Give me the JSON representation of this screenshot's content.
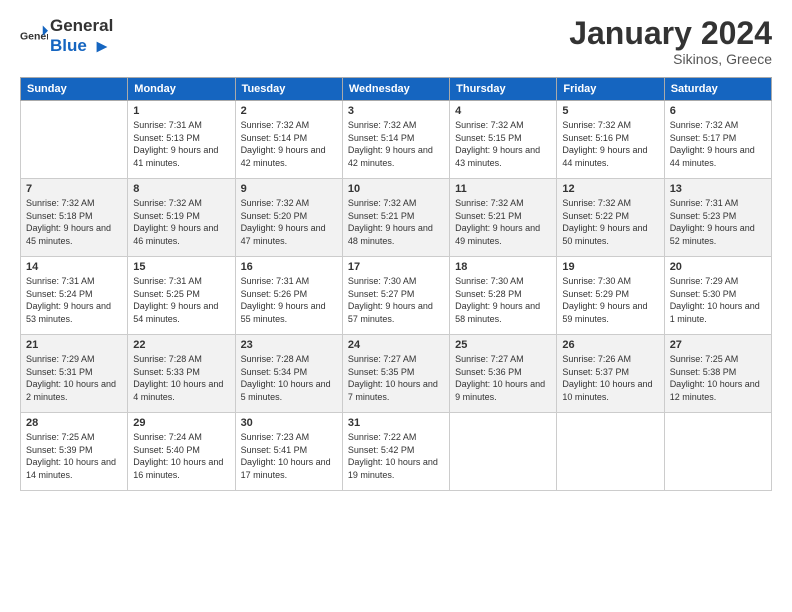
{
  "header": {
    "logo_general": "General",
    "logo_blue": "Blue",
    "month_title": "January 2024",
    "location": "Sikinos, Greece"
  },
  "days_of_week": [
    "Sunday",
    "Monday",
    "Tuesday",
    "Wednesday",
    "Thursday",
    "Friday",
    "Saturday"
  ],
  "weeks": [
    [
      {
        "day": "",
        "sunrise": "",
        "sunset": "",
        "daylight": ""
      },
      {
        "day": "1",
        "sunrise": "Sunrise: 7:31 AM",
        "sunset": "Sunset: 5:13 PM",
        "daylight": "Daylight: 9 hours and 41 minutes."
      },
      {
        "day": "2",
        "sunrise": "Sunrise: 7:32 AM",
        "sunset": "Sunset: 5:14 PM",
        "daylight": "Daylight: 9 hours and 42 minutes."
      },
      {
        "day": "3",
        "sunrise": "Sunrise: 7:32 AM",
        "sunset": "Sunset: 5:14 PM",
        "daylight": "Daylight: 9 hours and 42 minutes."
      },
      {
        "day": "4",
        "sunrise": "Sunrise: 7:32 AM",
        "sunset": "Sunset: 5:15 PM",
        "daylight": "Daylight: 9 hours and 43 minutes."
      },
      {
        "day": "5",
        "sunrise": "Sunrise: 7:32 AM",
        "sunset": "Sunset: 5:16 PM",
        "daylight": "Daylight: 9 hours and 44 minutes."
      },
      {
        "day": "6",
        "sunrise": "Sunrise: 7:32 AM",
        "sunset": "Sunset: 5:17 PM",
        "daylight": "Daylight: 9 hours and 44 minutes."
      }
    ],
    [
      {
        "day": "7",
        "sunrise": "Sunrise: 7:32 AM",
        "sunset": "Sunset: 5:18 PM",
        "daylight": "Daylight: 9 hours and 45 minutes."
      },
      {
        "day": "8",
        "sunrise": "Sunrise: 7:32 AM",
        "sunset": "Sunset: 5:19 PM",
        "daylight": "Daylight: 9 hours and 46 minutes."
      },
      {
        "day": "9",
        "sunrise": "Sunrise: 7:32 AM",
        "sunset": "Sunset: 5:20 PM",
        "daylight": "Daylight: 9 hours and 47 minutes."
      },
      {
        "day": "10",
        "sunrise": "Sunrise: 7:32 AM",
        "sunset": "Sunset: 5:21 PM",
        "daylight": "Daylight: 9 hours and 48 minutes."
      },
      {
        "day": "11",
        "sunrise": "Sunrise: 7:32 AM",
        "sunset": "Sunset: 5:21 PM",
        "daylight": "Daylight: 9 hours and 49 minutes."
      },
      {
        "day": "12",
        "sunrise": "Sunrise: 7:32 AM",
        "sunset": "Sunset: 5:22 PM",
        "daylight": "Daylight: 9 hours and 50 minutes."
      },
      {
        "day": "13",
        "sunrise": "Sunrise: 7:31 AM",
        "sunset": "Sunset: 5:23 PM",
        "daylight": "Daylight: 9 hours and 52 minutes."
      }
    ],
    [
      {
        "day": "14",
        "sunrise": "Sunrise: 7:31 AM",
        "sunset": "Sunset: 5:24 PM",
        "daylight": "Daylight: 9 hours and 53 minutes."
      },
      {
        "day": "15",
        "sunrise": "Sunrise: 7:31 AM",
        "sunset": "Sunset: 5:25 PM",
        "daylight": "Daylight: 9 hours and 54 minutes."
      },
      {
        "day": "16",
        "sunrise": "Sunrise: 7:31 AM",
        "sunset": "Sunset: 5:26 PM",
        "daylight": "Daylight: 9 hours and 55 minutes."
      },
      {
        "day": "17",
        "sunrise": "Sunrise: 7:30 AM",
        "sunset": "Sunset: 5:27 PM",
        "daylight": "Daylight: 9 hours and 57 minutes."
      },
      {
        "day": "18",
        "sunrise": "Sunrise: 7:30 AM",
        "sunset": "Sunset: 5:28 PM",
        "daylight": "Daylight: 9 hours and 58 minutes."
      },
      {
        "day": "19",
        "sunrise": "Sunrise: 7:30 AM",
        "sunset": "Sunset: 5:29 PM",
        "daylight": "Daylight: 9 hours and 59 minutes."
      },
      {
        "day": "20",
        "sunrise": "Sunrise: 7:29 AM",
        "sunset": "Sunset: 5:30 PM",
        "daylight": "Daylight: 10 hours and 1 minute."
      }
    ],
    [
      {
        "day": "21",
        "sunrise": "Sunrise: 7:29 AM",
        "sunset": "Sunset: 5:31 PM",
        "daylight": "Daylight: 10 hours and 2 minutes."
      },
      {
        "day": "22",
        "sunrise": "Sunrise: 7:28 AM",
        "sunset": "Sunset: 5:33 PM",
        "daylight": "Daylight: 10 hours and 4 minutes."
      },
      {
        "day": "23",
        "sunrise": "Sunrise: 7:28 AM",
        "sunset": "Sunset: 5:34 PM",
        "daylight": "Daylight: 10 hours and 5 minutes."
      },
      {
        "day": "24",
        "sunrise": "Sunrise: 7:27 AM",
        "sunset": "Sunset: 5:35 PM",
        "daylight": "Daylight: 10 hours and 7 minutes."
      },
      {
        "day": "25",
        "sunrise": "Sunrise: 7:27 AM",
        "sunset": "Sunset: 5:36 PM",
        "daylight": "Daylight: 10 hours and 9 minutes."
      },
      {
        "day": "26",
        "sunrise": "Sunrise: 7:26 AM",
        "sunset": "Sunset: 5:37 PM",
        "daylight": "Daylight: 10 hours and 10 minutes."
      },
      {
        "day": "27",
        "sunrise": "Sunrise: 7:25 AM",
        "sunset": "Sunset: 5:38 PM",
        "daylight": "Daylight: 10 hours and 12 minutes."
      }
    ],
    [
      {
        "day": "28",
        "sunrise": "Sunrise: 7:25 AM",
        "sunset": "Sunset: 5:39 PM",
        "daylight": "Daylight: 10 hours and 14 minutes."
      },
      {
        "day": "29",
        "sunrise": "Sunrise: 7:24 AM",
        "sunset": "Sunset: 5:40 PM",
        "daylight": "Daylight: 10 hours and 16 minutes."
      },
      {
        "day": "30",
        "sunrise": "Sunrise: 7:23 AM",
        "sunset": "Sunset: 5:41 PM",
        "daylight": "Daylight: 10 hours and 17 minutes."
      },
      {
        "day": "31",
        "sunrise": "Sunrise: 7:22 AM",
        "sunset": "Sunset: 5:42 PM",
        "daylight": "Daylight: 10 hours and 19 minutes."
      },
      {
        "day": "",
        "sunrise": "",
        "sunset": "",
        "daylight": ""
      },
      {
        "day": "",
        "sunrise": "",
        "sunset": "",
        "daylight": ""
      },
      {
        "day": "",
        "sunrise": "",
        "sunset": "",
        "daylight": ""
      }
    ]
  ]
}
